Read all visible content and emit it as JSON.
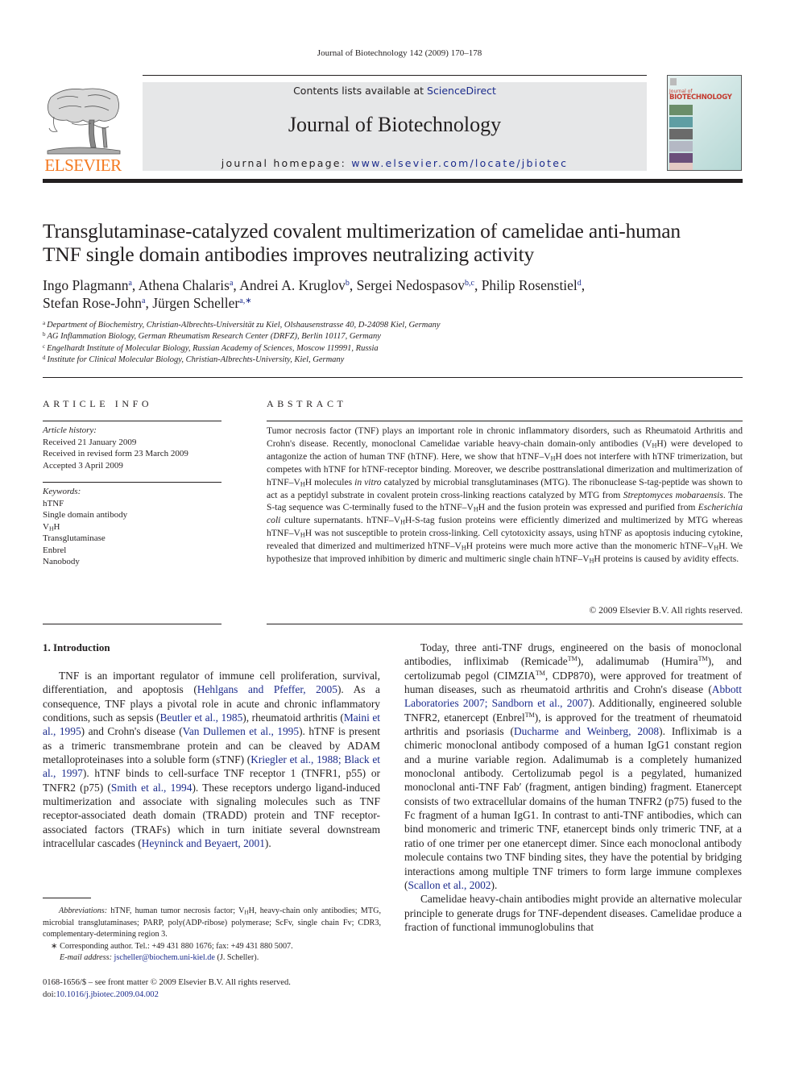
{
  "citation_line": "Journal of Biotechnology 142 (2009) 170–178",
  "header": {
    "contents_prefix": "Contents lists available at ",
    "contents_link": "ScienceDirect",
    "journal_title": "Journal of Biotechnology",
    "homepage_label": "journal homepage: ",
    "homepage_url": "www.elsevier.com/locate/jbiotec",
    "publisher_logo_text": "ELSEVIER",
    "cover_small": "Journal of",
    "cover_big": "BIOTECHNOLOGY"
  },
  "article": {
    "title_line1": "Transglutaminase-catalyzed covalent multimerization of camelidae anti-human",
    "title_line2": "TNF single domain antibodies improves neutralizing activity",
    "authors": [
      {
        "name": "Ingo Plagmann",
        "aff": "a",
        "sep": ", "
      },
      {
        "name": "Athena Chalaris",
        "aff": "a",
        "sep": ", "
      },
      {
        "name": "Andrei A. Kruglov",
        "aff": "b",
        "sep": ", "
      },
      {
        "name": "Sergei Nedospasov",
        "aff": "b,c",
        "sep": ", "
      },
      {
        "name": "Philip Rosenstiel",
        "aff": "d",
        "sep": ","
      },
      {
        "name": "Stefan Rose-John",
        "aff": "a",
        "sep": ", "
      },
      {
        "name": "Jürgen Scheller",
        "aff": "a,∗",
        "sep": ""
      }
    ],
    "affiliations": [
      {
        "key": "a",
        "text": "Department of Biochemistry, Christian-Albrechts-Universität zu Kiel, Olshausenstrasse 40, D-24098 Kiel, Germany"
      },
      {
        "key": "b",
        "text": "AG Inflammation Biology, German Rheumatism Research Center (DRFZ), Berlin 10117, Germany"
      },
      {
        "key": "c",
        "text": "Engelhardt Institute of Molecular Biology, Russian Academy of Sciences, Moscow 119991, Russia"
      },
      {
        "key": "d",
        "text": "Institute for Clinical Molecular Biology, Christian-Albrechts-University, Kiel, Germany"
      }
    ]
  },
  "article_info": {
    "heading": "ARTICLE INFO",
    "history_label": "Article history:",
    "history": [
      "Received 21 January 2009",
      "Received in revised form 23 March 2009",
      "Accepted 3 April 2009"
    ],
    "keywords_label": "Keywords:",
    "keywords": [
      "hTNF",
      "Single domain antibody",
      "VHH",
      "Transglutaminase",
      "Enbrel",
      "Nanobody"
    ]
  },
  "abstract": {
    "heading": "ABSTRACT",
    "text": "Tumor necrosis factor (TNF) plays an important role in chronic inflammatory disorders, such as Rheumatoid Arthritis and Crohn's disease. Recently, monoclonal Camelidae variable heavy-chain domain-only antibodies (VHH) were developed to antagonize the action of human TNF (hTNF). Here, we show that hTNF–VHH does not interfere with hTNF trimerization, but competes with hTNF for hTNF-receptor binding. Moreover, we describe posttranslational dimerization and multimerization of hTNF–VHH molecules in vitro catalyzed by microbial transglutaminases (MTG). The ribonuclease S-tag-peptide was shown to act as a peptidyl substrate in covalent protein cross-linking reactions catalyzed by MTG from Streptomyces mobaraensis. The S-tag sequence was C-terminally fused to the hTNF–VHH and the fusion protein was expressed and purified from Escherichia coli culture supernatants. hTNF–VHH-S-tag fusion proteins were efficiently dimerized and multimerized by MTG whereas hTNF–VHH was not susceptible to protein cross-linking. Cell cytotoxicity assays, using hTNF as apoptosis inducing cytokine, revealed that dimerized and multimerized hTNF–VHH proteins were much more active than the monomeric hTNF–VHH. We hypothesize that improved inhibition by dimeric and multimeric single chain hTNF–VHH proteins is caused by avidity effects.",
    "copyright": "© 2009 Elsevier B.V. All rights reserved."
  },
  "body": {
    "section_heading": "1.  Introduction",
    "left_col": [
      [
        {
          "t": "TNF is an important regulator of immune cell proliferation, survival, differentiation, and apoptosis ("
        },
        {
          "c": "Hehlgans and Pfeffer, 2005"
        },
        {
          "t": "). As a consequence, TNF plays a pivotal role in acute and chronic inflammatory conditions, such as sepsis ("
        },
        {
          "c": "Beutler et al., 1985"
        },
        {
          "t": "), rheumatoid arthritis ("
        },
        {
          "c": "Maini et al., 1995"
        },
        {
          "t": ") and Crohn's disease ("
        },
        {
          "c": "Van Dullemen et al., 1995"
        },
        {
          "t": "). hTNF is present as a trimeric transmembrane protein and can be cleaved by ADAM metalloproteinases into a soluble form (sTNF) ("
        },
        {
          "c": "Kriegler et al., 1988; Black et al., 1997"
        },
        {
          "t": "). hTNF binds to cell-surface TNF receptor 1 (TNFR1, p55) or TNFR2 (p75) ("
        },
        {
          "c": "Smith et al., 1994"
        },
        {
          "t": "). These receptors undergo ligand-induced multimerization and associate with signaling molecules such as TNF receptor-associated death domain (TRADD) protein and TNF receptor-associated factors (TRAFs) which in turn initiate several downstream intracellular cascades ("
        },
        {
          "c": "Heyninck and Beyaert, 2001"
        },
        {
          "t": ")."
        }
      ]
    ],
    "right_col": [
      [
        {
          "t": "Today, three anti-TNF drugs, engineered on the basis of monoclonal antibodies, infliximab (Remicade"
        },
        {
          "s": "TM"
        },
        {
          "t": "), adalimumab (Humira"
        },
        {
          "s": "TM"
        },
        {
          "t": "), and certolizumab pegol (CIMZIA"
        },
        {
          "s": "TM"
        },
        {
          "t": ", CDP870), were approved for treatment of human diseases, such as rheumatoid arthritis and Crohn's disease ("
        },
        {
          "c": "Abbott Laboratories 2007; Sandborn et al., 2007"
        },
        {
          "t": "). Additionally, engineered soluble TNFR2, etanercept (Enbrel"
        },
        {
          "s": "TM"
        },
        {
          "t": "), is approved for the treatment of rheumatoid arthritis and psoriasis ("
        },
        {
          "c": "Ducharme and Weinberg, 2008"
        },
        {
          "t": "). Infliximab is a chimeric monoclonal antibody composed of a human IgG1 constant region and a murine variable region. Adalimumab is a completely humanized monoclonal antibody. Certolizumab pegol is a pegylated, humanized monoclonal anti-TNF Fab′ (fragment, antigen binding) fragment. Etanercept consists of two extracellular domains of the human TNFR2 (p75) fused to the Fc fragment of a human IgG1. In contrast to anti-TNF antibodies, which can bind monomeric and trimeric TNF, etanercept binds only trimeric TNF, at a ratio of one trimer per one etanercept dimer. Since each monoclonal antibody molecule contains two TNF binding sites, they have the potential by bridging interactions among multiple TNF trimers to form large immune complexes ("
        },
        {
          "c": "Scallon et al., 2002"
        },
        {
          "t": ")."
        }
      ],
      [
        {
          "t": "Camelidae heavy-chain antibodies might provide an alternative molecular principle to generate drugs for TNF-dependent diseases. Camelidae produce a fraction of functional immunoglobulins that"
        }
      ]
    ]
  },
  "footnotes": {
    "abbrev_label": "Abbreviations:",
    "abbrev_text": " hTNF, human tumor necrosis factor; VHH, heavy-chain only antibodies; MTG, microbial transglutaminases; PARP, poly(ADP-ribose) polymerase; ScFv, single chain Fv; CDR3, complementary-determining region 3.",
    "corresponding": "∗  Corresponding author. Tel.: +49 431 880 1676; fax: +49 431 880 5007.",
    "email_label": "E-mail address:",
    "email": "jscheller@biochem.uni-kiel.de",
    "email_suffix": " (J. Scheller)."
  },
  "front_matter": {
    "issn_line": "0168-1656/$ – see front matter © 2009 Elsevier B.V. All rights reserved.",
    "doi_label": "doi:",
    "doi": "10.1016/j.jbiotec.2009.04.002"
  },
  "colors": {
    "link": "#1c2c8c",
    "elsevier_orange": "#f47920",
    "header_gray": "#e6e7e8",
    "text": "#231f20"
  }
}
